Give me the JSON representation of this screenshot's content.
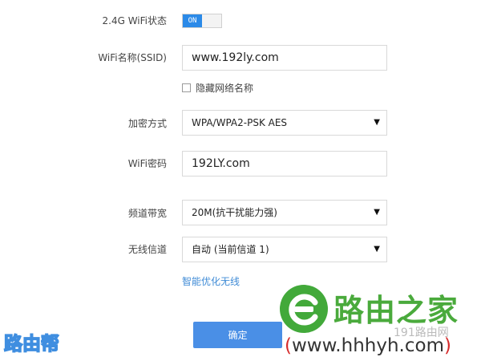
{
  "wifi24": {
    "status_label": "2.4G WiFi状态",
    "toggle_text": "ON",
    "ssid_label": "WiFi名称(SSID)",
    "ssid_value": "www.192ly.com",
    "hide_label": "隐藏网络名称",
    "encryption_label": "加密方式",
    "encryption_value": "WPA/WPA2-PSK AES",
    "password_label": "WiFi密码",
    "password_value": "192LY.com",
    "bandwidth_label": "频道带宽",
    "bandwidth_value": "20M(抗干扰能力强)",
    "channel_label": "无线信道",
    "channel_value": "自动 (当前信道 1)",
    "optimize_link": "智能优化无线",
    "confirm_button": "确定"
  },
  "watermark": {
    "left_text": "路由帮",
    "logo_text": "路由之家",
    "logo_sub": "191路由网",
    "url_open": "(",
    "url_text": "www.hhhyh.com",
    "url_close": ")"
  },
  "colors": {
    "accent": "#2b8ae8",
    "button": "#4a8fe6",
    "link": "#3f8bd6",
    "logo_green": "#42a93a"
  },
  "icons": {
    "dropdown_arrow": "▼"
  }
}
